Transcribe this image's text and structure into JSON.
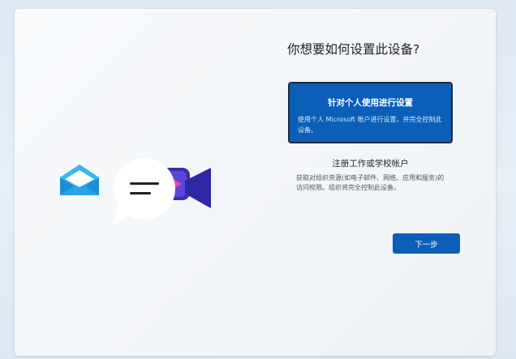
{
  "page": {
    "title": "你想要如何设置此设备?",
    "options": [
      {
        "title": "针对个人使用进行设置",
        "description": "使用个人 Microsoft 帐户进行设置，并完全控制此设备。",
        "selected": true
      },
      {
        "title": "注册工作或学校帐户",
        "description": "获取对组织资源(如电子邮件、网络、应用和服务)的访问权限。组织将完全控制此设备。",
        "selected": false
      }
    ],
    "next_label": "下一步"
  },
  "illustration": {
    "icons": [
      "mail-icon",
      "chat-bubble-icon",
      "video-camera-icon"
    ]
  },
  "colors": {
    "accent": "#0b5fb8",
    "selected_border": "#1e2a38",
    "background": "#e3ecf5"
  }
}
